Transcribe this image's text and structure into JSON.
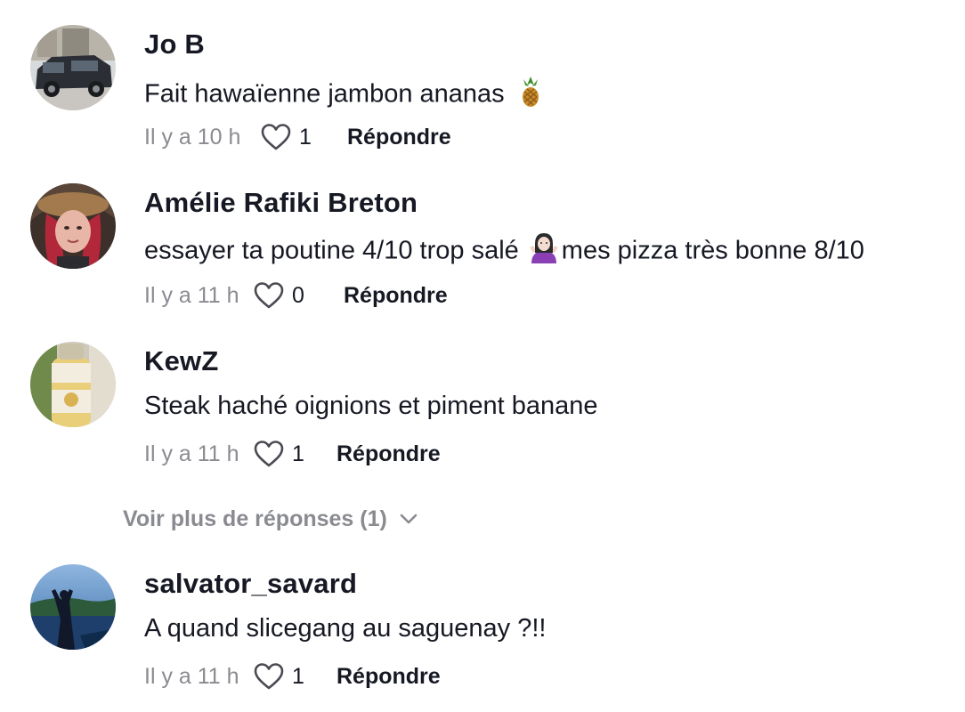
{
  "comments": [
    {
      "username": "Jo B",
      "text_before": "Fait hawaïenne jambon ananas",
      "emoji": "pineapple-emoji",
      "text_after": "",
      "time": "Il y a 10 h",
      "likes": "1",
      "reply_label": "Répondre"
    },
    {
      "username": "Amélie Rafiki Breton",
      "text_before": "essayer ta poutine 4/10 trop salé",
      "emoji": "shrugging-woman-emoji",
      "text_after": "mes pizza très bonne 8/10",
      "time": "Il y a 11 h",
      "likes": "0",
      "reply_label": "Répondre"
    },
    {
      "username": "KewZ",
      "text_before": "Steak haché oignions et piment banane",
      "emoji": "",
      "text_after": "",
      "time": "Il y a 11 h",
      "likes": "1",
      "reply_label": "Répondre"
    },
    {
      "username": "salvator_savard",
      "text_before": "A quand slicegang au saguenay ?!!",
      "emoji": "",
      "text_after": "",
      "time": "Il y a 11 h",
      "likes": "1",
      "reply_label": "Répondre"
    }
  ],
  "more_replies": {
    "label": "Voir plus de réponses (1)",
    "icon": "chevron-down-icon"
  },
  "colors": {
    "primary_text": "#161823",
    "secondary_text": "#8a8b91"
  }
}
